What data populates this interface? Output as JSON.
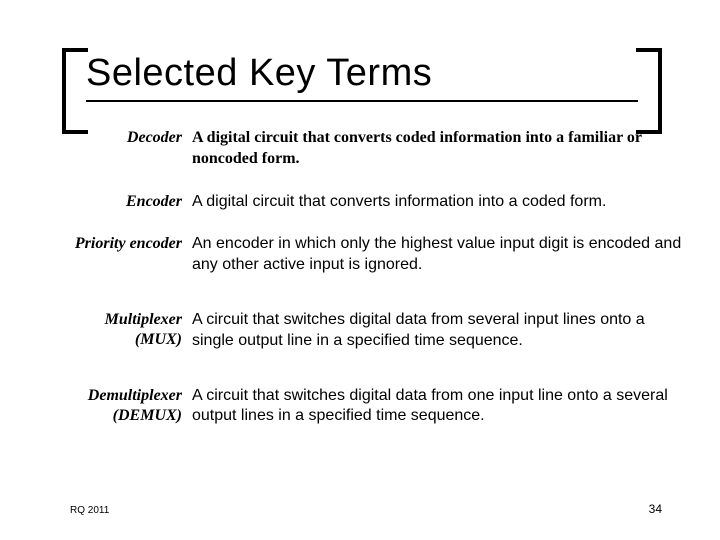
{
  "title": "Selected Key Terms",
  "terms": {
    "decoder": {
      "label": "Decoder",
      "sub": "",
      "definition": "A digital circuit that converts coded information into a familiar or noncoded form."
    },
    "encoder": {
      "label": "Encoder",
      "sub": "",
      "definition": "A digital circuit that converts information into a coded form."
    },
    "priority": {
      "label": "Priority encoder",
      "sub": "",
      "definition": "An encoder in which only the highest value input digit is encoded and any other active input is ignored."
    },
    "mux": {
      "label": "Multiplexer",
      "sub": "(MUX)",
      "definition": "A circuit that switches digital data from several input lines onto a single output line in a specified time sequence."
    },
    "demux": {
      "label": "Demultiplexer",
      "sub": "(DEMUX)",
      "definition": "A circuit that switches digital data from one input line onto a several output lines in a specified time sequence."
    }
  },
  "footer": {
    "left": "RQ 2011",
    "page": "34"
  }
}
